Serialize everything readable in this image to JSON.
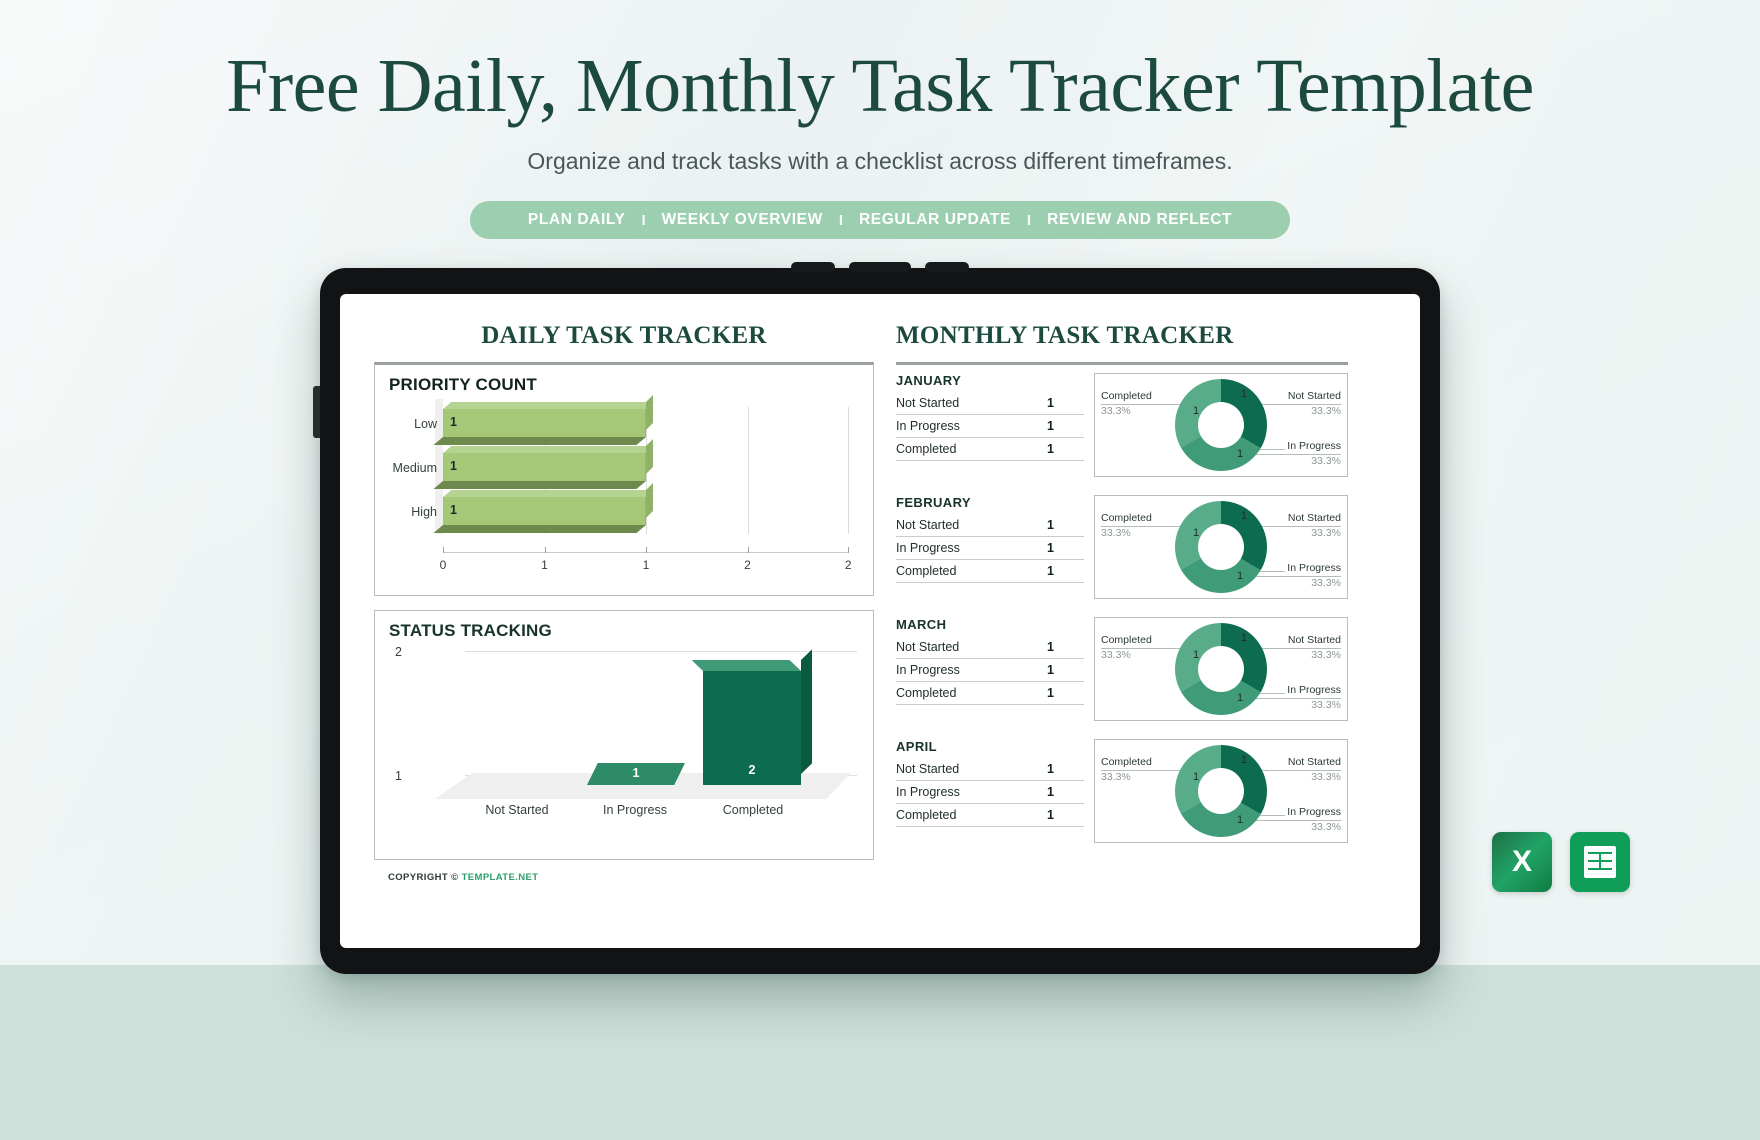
{
  "hero": {
    "title": "Free Daily, Monthly Task Tracker Template",
    "subtitle": "Organize and track tasks with a checklist across different timeframes.",
    "pill_items": [
      "PLAN DAILY",
      "WEEKLY OVERVIEW",
      "REGULAR UPDATE",
      "REVIEW AND REFLECT"
    ],
    "separator": "I",
    "accent_green": "#1d4a3e",
    "pill_bg": "#9ccfb0"
  },
  "sheet": {
    "daily_title": "DAILY TASK TRACKER",
    "monthly_title": "MONTHLY TASK TRACKER",
    "priority_heading": "PRIORITY COUNT",
    "status_heading": "STATUS TRACKING",
    "copyright_prefix": "COPYRIGHT ©",
    "copyright_brand": "TEMPLATE.NET"
  },
  "chart_data": [
    {
      "type": "bar",
      "title": "PRIORITY COUNT",
      "orientation": "horizontal",
      "categories": [
        "Low",
        "Medium",
        "High"
      ],
      "values": [
        1,
        1,
        1
      ],
      "data_labels": [
        "1",
        "1",
        "1"
      ],
      "xticks": [
        "0",
        "1",
        "1",
        "2",
        "2"
      ],
      "xlabel": "",
      "ylabel": "",
      "xlim": [
        0,
        2
      ],
      "grid": true,
      "series_color": "#a4c878"
    },
    {
      "type": "bar",
      "title": "STATUS TRACKING",
      "orientation": "vertical",
      "categories": [
        "Not Started",
        "In Progress",
        "Completed"
      ],
      "values": [
        0,
        1,
        2
      ],
      "data_labels": [
        "",
        "1",
        "2"
      ],
      "yticks": [
        "2",
        "1"
      ],
      "ylim": [
        0,
        2
      ],
      "grid": true,
      "series_color": "#0d6b4f"
    },
    {
      "type": "pie",
      "title": "JANUARY",
      "labels": [
        "Not Started",
        "In Progress",
        "Completed"
      ],
      "values": [
        1,
        1,
        1
      ],
      "percents": [
        "33.3%",
        "33.3%",
        "33.3%"
      ],
      "colors": [
        "#0d6b4f",
        "#3f9b78",
        "#59ac8a"
      ]
    },
    {
      "type": "pie",
      "title": "FEBRUARY",
      "labels": [
        "Not Started",
        "In Progress",
        "Completed"
      ],
      "values": [
        1,
        1,
        1
      ],
      "percents": [
        "33.3%",
        "33.3%",
        "33.3%"
      ],
      "colors": [
        "#0d6b4f",
        "#3f9b78",
        "#59ac8a"
      ]
    },
    {
      "type": "pie",
      "title": "MARCH",
      "labels": [
        "Not Started",
        "In Progress",
        "Completed"
      ],
      "values": [
        1,
        1,
        1
      ],
      "percents": [
        "33.3%",
        "33.3%",
        "33.3%"
      ],
      "colors": [
        "#0d6b4f",
        "#3f9b78",
        "#59ac8a"
      ]
    },
    {
      "type": "pie",
      "title": "APRIL",
      "labels": [
        "Not Started",
        "In Progress",
        "Completed"
      ],
      "values": [
        1,
        1,
        1
      ],
      "percents": [
        "33.3%",
        "33.3%",
        "33.3%"
      ],
      "colors": [
        "#0d6b4f",
        "#3f9b78",
        "#59ac8a"
      ]
    }
  ],
  "priority": {
    "rows": [
      {
        "label": "Low",
        "value": "1"
      },
      {
        "label": "Medium",
        "value": "1"
      },
      {
        "label": "High",
        "value": "1"
      }
    ],
    "ticks": [
      "0",
      "1",
      "1",
      "2",
      "2"
    ]
  },
  "status": {
    "yticks": [
      "2",
      "1"
    ],
    "bars": [
      {
        "label": "Not Started",
        "value": ""
      },
      {
        "label": "In Progress",
        "value": "1"
      },
      {
        "label": "Completed",
        "value": "2"
      }
    ]
  },
  "months": [
    {
      "name": "JANUARY",
      "rows": [
        {
          "key": "Not Started",
          "value": "1"
        },
        {
          "key": "In Progress",
          "value": "1"
        },
        {
          "key": "Completed",
          "value": "1"
        }
      ],
      "donut": {
        "completed_label": "Completed",
        "completed_pct": "33.3%",
        "completed_num": "1",
        "not_started_label": "Not Started",
        "not_started_pct": "33.3%",
        "not_started_num": "1",
        "in_progress_label": "In Progress",
        "in_progress_pct": "33.3%",
        "in_progress_num": "1"
      }
    },
    {
      "name": "FEBRUARY",
      "rows": [
        {
          "key": "Not Started",
          "value": "1"
        },
        {
          "key": "In Progress",
          "value": "1"
        },
        {
          "key": "Completed",
          "value": "1"
        }
      ],
      "donut": {
        "completed_label": "Completed",
        "completed_pct": "33.3%",
        "completed_num": "1",
        "not_started_label": "Not Started",
        "not_started_pct": "33.3%",
        "not_started_num": "1",
        "in_progress_label": "In Progress",
        "in_progress_pct": "33.3%",
        "in_progress_num": "1"
      }
    },
    {
      "name": "MARCH",
      "rows": [
        {
          "key": "Not Started",
          "value": "1"
        },
        {
          "key": "In Progress",
          "value": "1"
        },
        {
          "key": "Completed",
          "value": "1"
        }
      ],
      "donut": {
        "completed_label": "Completed",
        "completed_pct": "33.3%",
        "completed_num": "1",
        "not_started_label": "Not Started",
        "not_started_pct": "33.3%",
        "not_started_num": "1",
        "in_progress_label": "In Progress",
        "in_progress_pct": "33.3%",
        "in_progress_num": "1"
      }
    },
    {
      "name": "APRIL",
      "rows": [
        {
          "key": "Not Started",
          "value": "1"
        },
        {
          "key": "In Progress",
          "value": "1"
        },
        {
          "key": "Completed",
          "value": "1"
        }
      ],
      "donut": {
        "completed_label": "Completed",
        "completed_pct": "33.3%",
        "completed_num": "1",
        "not_started_label": "Not Started",
        "not_started_pct": "33.3%",
        "not_started_num": "1",
        "in_progress_label": "In Progress",
        "in_progress_pct": "33.3%",
        "in_progress_num": "1"
      }
    }
  ],
  "file_icons": [
    {
      "name": "excel-icon",
      "glyph": "X"
    },
    {
      "name": "google-sheets-icon",
      "glyph": ""
    }
  ]
}
